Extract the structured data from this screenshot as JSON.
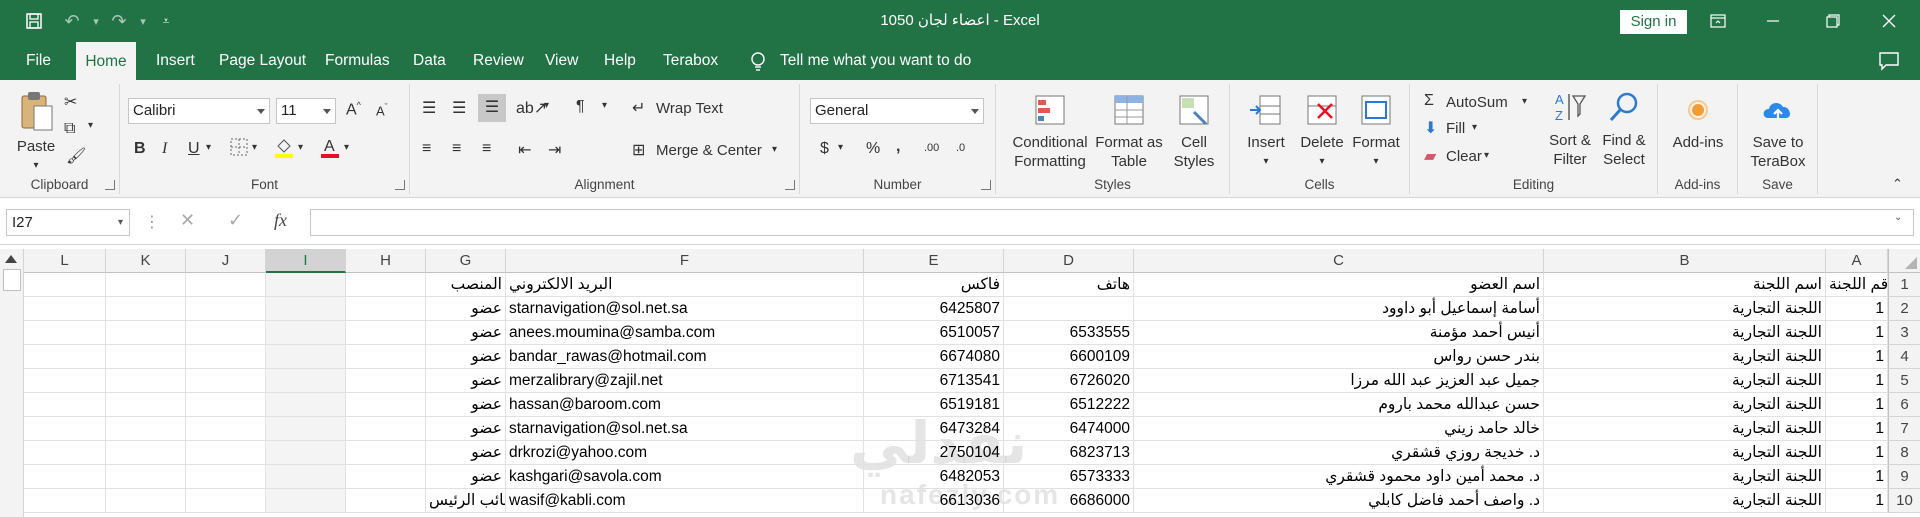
{
  "title_bar": {
    "title": "اعضاء لجان 1050  -  Excel",
    "sign_in": "Sign in"
  },
  "tabs": [
    "File",
    "Home",
    "Insert",
    "Page Layout",
    "Formulas",
    "Data",
    "Review",
    "View",
    "Help",
    "Terabox"
  ],
  "active_tab": "Home",
  "tell_me": "Tell me what you want to do",
  "ribbon": {
    "clipboard": {
      "label": "Clipboard",
      "paste": "Paste"
    },
    "font": {
      "label": "Font",
      "name": "Calibri",
      "size": "11"
    },
    "alignment": {
      "label": "Alignment",
      "wrap_text": "Wrap Text",
      "merge_center": "Merge & Center"
    },
    "number": {
      "label": "Number",
      "format": "General"
    },
    "styles": {
      "label": "Styles",
      "conditional_1": "Conditional",
      "conditional_2": "Formatting",
      "format_as_1": "Format as",
      "format_as_2": "Table",
      "cell_styles_1": "Cell",
      "cell_styles_2": "Styles"
    },
    "cells": {
      "label": "Cells",
      "insert": "Insert",
      "delete": "Delete",
      "format": "Format"
    },
    "editing": {
      "label": "Editing",
      "autosum": "AutoSum",
      "fill": "Fill",
      "clear": "Clear",
      "sort_1": "Sort &",
      "sort_2": "Filter",
      "find_1": "Find &",
      "find_2": "Select"
    },
    "addins": {
      "label": "Add-ins",
      "addins": "Add-ins"
    },
    "save": {
      "label": "Save",
      "save_1": "Save to",
      "save_2": "TeraBox"
    }
  },
  "formula_bar": {
    "name_box": "I27",
    "fx": "fx",
    "value": ""
  },
  "columns": [
    "L",
    "K",
    "J",
    "I",
    "H",
    "G",
    "F",
    "E",
    "D",
    "C",
    "B",
    "A"
  ],
  "selected_column": "I",
  "rows": [
    {
      "num": "1",
      "A": "رقم اللجنة",
      "B": "اسم اللجنة",
      "C": "اسم العضو",
      "D": "هاتف",
      "E": "فاكس",
      "F": "البريد الالكتروني",
      "G": "المنصب"
    },
    {
      "num": "2",
      "A": "1",
      "B": "اللجنة التجارية",
      "C": "أسامة إسماعيل أبو داوود",
      "D": "",
      "E": "6425807",
      "F": "starnavigation@sol.net.sa",
      "G": "عضو"
    },
    {
      "num": "3",
      "A": "1",
      "B": "اللجنة التجارية",
      "C": "أنيس أحمد مؤمنة",
      "D": "6533555",
      "E": "6510057",
      "F": "anees.moumina@samba.com",
      "G": "عضو"
    },
    {
      "num": "4",
      "A": "1",
      "B": "اللجنة التجارية",
      "C": "بندر حسن رواس",
      "D": "6600109",
      "E": "6674080",
      "F": "bandar_rawas@hotmail.com",
      "G": "عضو"
    },
    {
      "num": "5",
      "A": "1",
      "B": "اللجنة التجارية",
      "C": "جميل عبد العزيز عبد الله مرزا",
      "D": "6726020",
      "E": "6713541",
      "F": "merzalibrary@zajil.net",
      "G": "عضو"
    },
    {
      "num": "6",
      "A": "1",
      "B": "اللجنة التجارية",
      "C": "حسن عبدالله محمد باروم",
      "D": "6512222",
      "E": "6519181",
      "F": "hassan@baroom.com",
      "G": "عضو"
    },
    {
      "num": "7",
      "A": "1",
      "B": "اللجنة التجارية",
      "C": "خالد حامد زيني",
      "D": "6474000",
      "E": "6473284",
      "F": "starnavigation@sol.net.sa",
      "G": "عضو"
    },
    {
      "num": "8",
      "A": "1",
      "B": "اللجنة التجارية",
      "C": "د. خديجة روزي قشقري",
      "D": "6823713",
      "E": "2750104",
      "F": "drkrozi@yahoo.com",
      "G": "عضو"
    },
    {
      "num": "9",
      "A": "1",
      "B": "اللجنة التجارية",
      "C": "د. محمد أمين داود محمود قشقري",
      "D": "6573333",
      "E": "6482053",
      "F": "kashgari@savola.com",
      "G": "عضو"
    },
    {
      "num": "10",
      "A": "1",
      "B": "اللجنة التجارية",
      "C": "د. واصف أحمد فاضل كابلي",
      "D": "6686000",
      "E": "6613036",
      "F": "wasif@kabli.com",
      "G": "نائب الرئيس"
    }
  ],
  "watermark": {
    "arabic": "نفذلي",
    "latin": "nafezly.com"
  },
  "colors": {
    "excel_green": "#217346",
    "ribbon_bg": "#f3f3f3"
  }
}
